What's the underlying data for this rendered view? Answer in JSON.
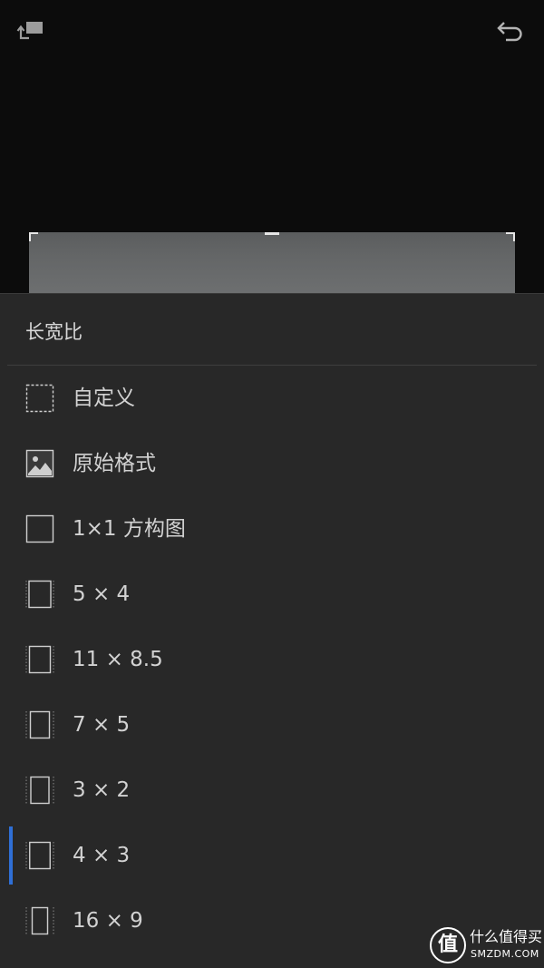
{
  "toolbar": {
    "left_icon": "rotate-icon",
    "right_icon": "undo-icon"
  },
  "panel": {
    "title": "长宽比"
  },
  "aspect_ratios": [
    {
      "label": "自定义",
      "icon": "custom-crop-icon",
      "selected": false
    },
    {
      "label": "原始格式",
      "icon": "original-image-icon",
      "selected": false
    },
    {
      "label": "1×1 方构图",
      "icon": "square-icon",
      "selected": false
    },
    {
      "label": "5 × 4",
      "icon": "ratio-icon",
      "selected": false
    },
    {
      "label": "11 × 8.5",
      "icon": "ratio-icon",
      "selected": false
    },
    {
      "label": "7 × 5",
      "icon": "ratio-icon",
      "selected": false
    },
    {
      "label": "3 × 2",
      "icon": "ratio-icon",
      "selected": false
    },
    {
      "label": "4 × 3",
      "icon": "ratio-icon",
      "selected": true
    },
    {
      "label": "16 × 9",
      "icon": "ratio-icon",
      "selected": false
    }
  ],
  "colors": {
    "background": "#0c0c0c",
    "panel": "#282828",
    "text": "#d2d2d2",
    "divider": "#3e3e3e",
    "accent": "#2f6fd6"
  },
  "watermark": {
    "glyph": "值",
    "brand": "什么值得买",
    "domain": "SMZDM.COM"
  }
}
